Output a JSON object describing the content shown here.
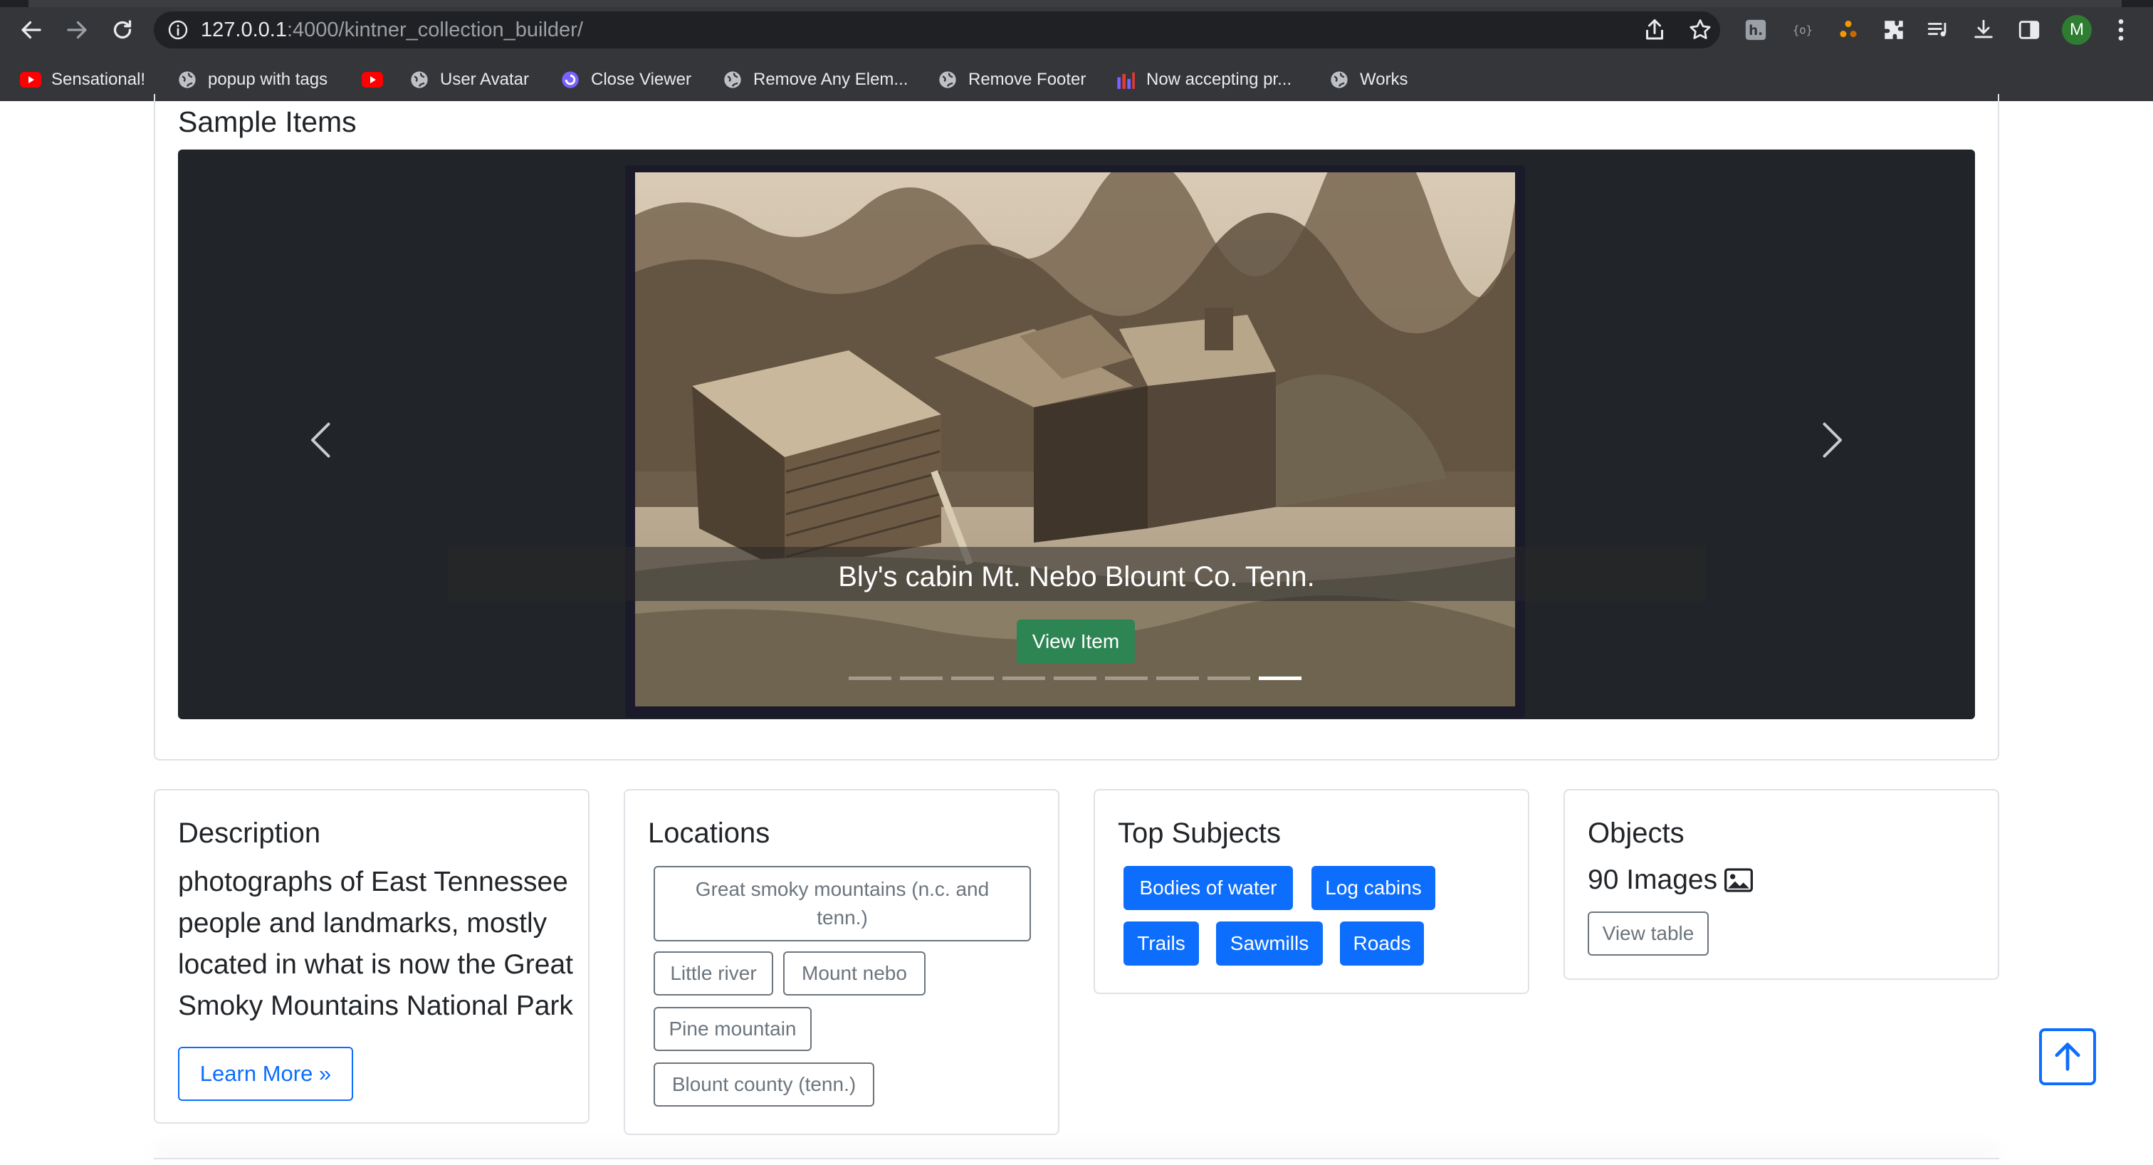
{
  "browser": {
    "url_host": "127.0.0.1",
    "url_rest": ":4000/kintner_collection_builder/",
    "profile_initial": "M",
    "bookmarks": [
      {
        "label": "Sensational!",
        "icon": "youtube-icon"
      },
      {
        "label": "popup with tags",
        "icon": "globe-icon"
      },
      {
        "label": "",
        "icon": "youtube-icon"
      },
      {
        "label": "User Avatar",
        "icon": "globe-icon"
      },
      {
        "label": "Close Viewer",
        "icon": "extension-swirl-icon"
      },
      {
        "label": "Remove Any Elem...",
        "icon": "globe-icon"
      },
      {
        "label": "Remove Footer",
        "icon": "globe-icon"
      },
      {
        "label": "Now accepting pr...",
        "icon": "bar-chart-icon"
      },
      {
        "label": "Works",
        "icon": "globe-icon"
      }
    ]
  },
  "sample_items": {
    "title": "Sample Items",
    "caption": "Bly's cabin Mt. Nebo Blount Co. Tenn.",
    "view_item_label": "View Item",
    "slide_count": 9,
    "active_slide": 9
  },
  "description": {
    "title": "Description",
    "text": "photographs of East Tennessee people and landmarks, mostly located in what is now the Great Smoky Mountains National Park",
    "learn_more_label": "Learn More »"
  },
  "locations": {
    "title": "Locations",
    "tags": [
      "Great smoky mountains (n.c. and tenn.)",
      "Little river",
      "Mount nebo",
      "Pine mountain",
      "Blount county (tenn.)"
    ]
  },
  "top_subjects": {
    "title": "Top Subjects",
    "tags": [
      "Bodies of water",
      "Log cabins",
      "Trails",
      "Sawmills",
      "Roads"
    ]
  },
  "objects": {
    "title": "Objects",
    "count_label": "90 Images",
    "view_table_label": "View table"
  },
  "colors": {
    "primary": "#0d6efd",
    "success": "#2e8554",
    "secondary": "#6c757d",
    "carousel_bg": "#212529"
  }
}
